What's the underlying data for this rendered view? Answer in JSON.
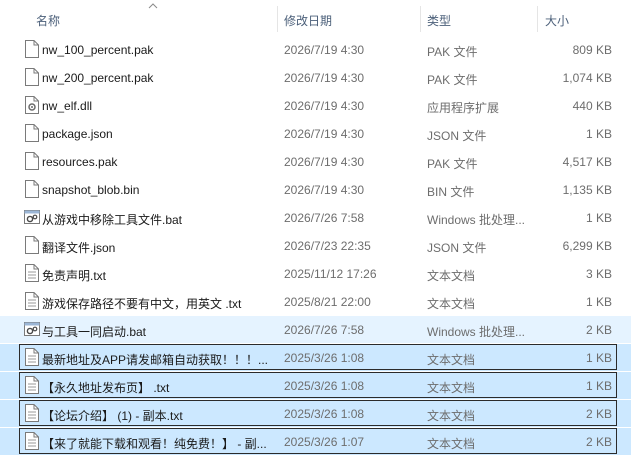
{
  "columns": {
    "name": "名称",
    "date": "修改日期",
    "type": "类型",
    "size": "大小"
  },
  "files": [
    {
      "name": "nw_100_percent.pak",
      "date": "2026/7/19 4:30",
      "type": "PAK 文件",
      "size": "809 KB",
      "icon": "file-icon",
      "state": "normal"
    },
    {
      "name": "nw_200_percent.pak",
      "date": "2026/7/19 4:30",
      "type": "PAK 文件",
      "size": "1,074 KB",
      "icon": "file-icon",
      "state": "normal"
    },
    {
      "name": "nw_elf.dll",
      "date": "2026/7/19 4:30",
      "type": "应用程序扩展",
      "size": "440 KB",
      "icon": "dll-file-icon",
      "state": "normal"
    },
    {
      "name": "package.json",
      "date": "2026/7/19 4:30",
      "type": "JSON 文件",
      "size": "1 KB",
      "icon": "file-icon",
      "state": "normal"
    },
    {
      "name": "resources.pak",
      "date": "2026/7/19 4:30",
      "type": "PAK 文件",
      "size": "4,517 KB",
      "icon": "file-icon",
      "state": "normal"
    },
    {
      "name": "snapshot_blob.bin",
      "date": "2026/7/19 4:30",
      "type": "BIN 文件",
      "size": "1,135 KB",
      "icon": "file-icon",
      "state": "normal"
    },
    {
      "name": "从游戏中移除工具文件.bat",
      "date": "2026/7/26 7:58",
      "type": "Windows 批处理...",
      "size": "1 KB",
      "icon": "batch-file-icon",
      "state": "normal"
    },
    {
      "name": "翻译文件.json",
      "date": "2026/7/23 22:35",
      "type": "JSON 文件",
      "size": "6,299 KB",
      "icon": "file-icon",
      "state": "normal"
    },
    {
      "name": "免责声明.txt",
      "date": "2025/11/12 17:26",
      "type": "文本文档",
      "size": "3 KB",
      "icon": "text-file-icon",
      "state": "normal"
    },
    {
      "name": "游戏保存路径不要有中文，用英文 .txt",
      "date": "2025/8/21 22:00",
      "type": "文本文档",
      "size": "1 KB",
      "icon": "text-file-icon",
      "state": "normal"
    },
    {
      "name": "与工具一同启动.bat",
      "date": "2026/7/26 7:58",
      "type": "Windows 批处理...",
      "size": "2 KB",
      "icon": "batch-file-icon",
      "state": "hover"
    },
    {
      "name": "最新地址及APP请发邮箱自动获取！！！...",
      "date": "2025/3/26 1:08",
      "type": "文本文档",
      "size": "1 KB",
      "icon": "text-file-icon",
      "state": "selected"
    },
    {
      "name": "【永久地址发布页】 .txt",
      "date": "2025/3/26 1:08",
      "type": "文本文档",
      "size": "1 KB",
      "icon": "text-file-icon",
      "state": "selected"
    },
    {
      "name": "【论坛介绍】 (1) - 副本.txt",
      "date": "2025/3/26 1:08",
      "type": "文本文档",
      "size": "2 KB",
      "icon": "text-file-icon",
      "state": "selected"
    },
    {
      "name": "【来了就能下载和观看！纯免费！】 - 副...",
      "date": "2025/3/26 1:07",
      "type": "文本文档",
      "size": "2 KB",
      "icon": "text-file-icon",
      "state": "selected"
    }
  ]
}
